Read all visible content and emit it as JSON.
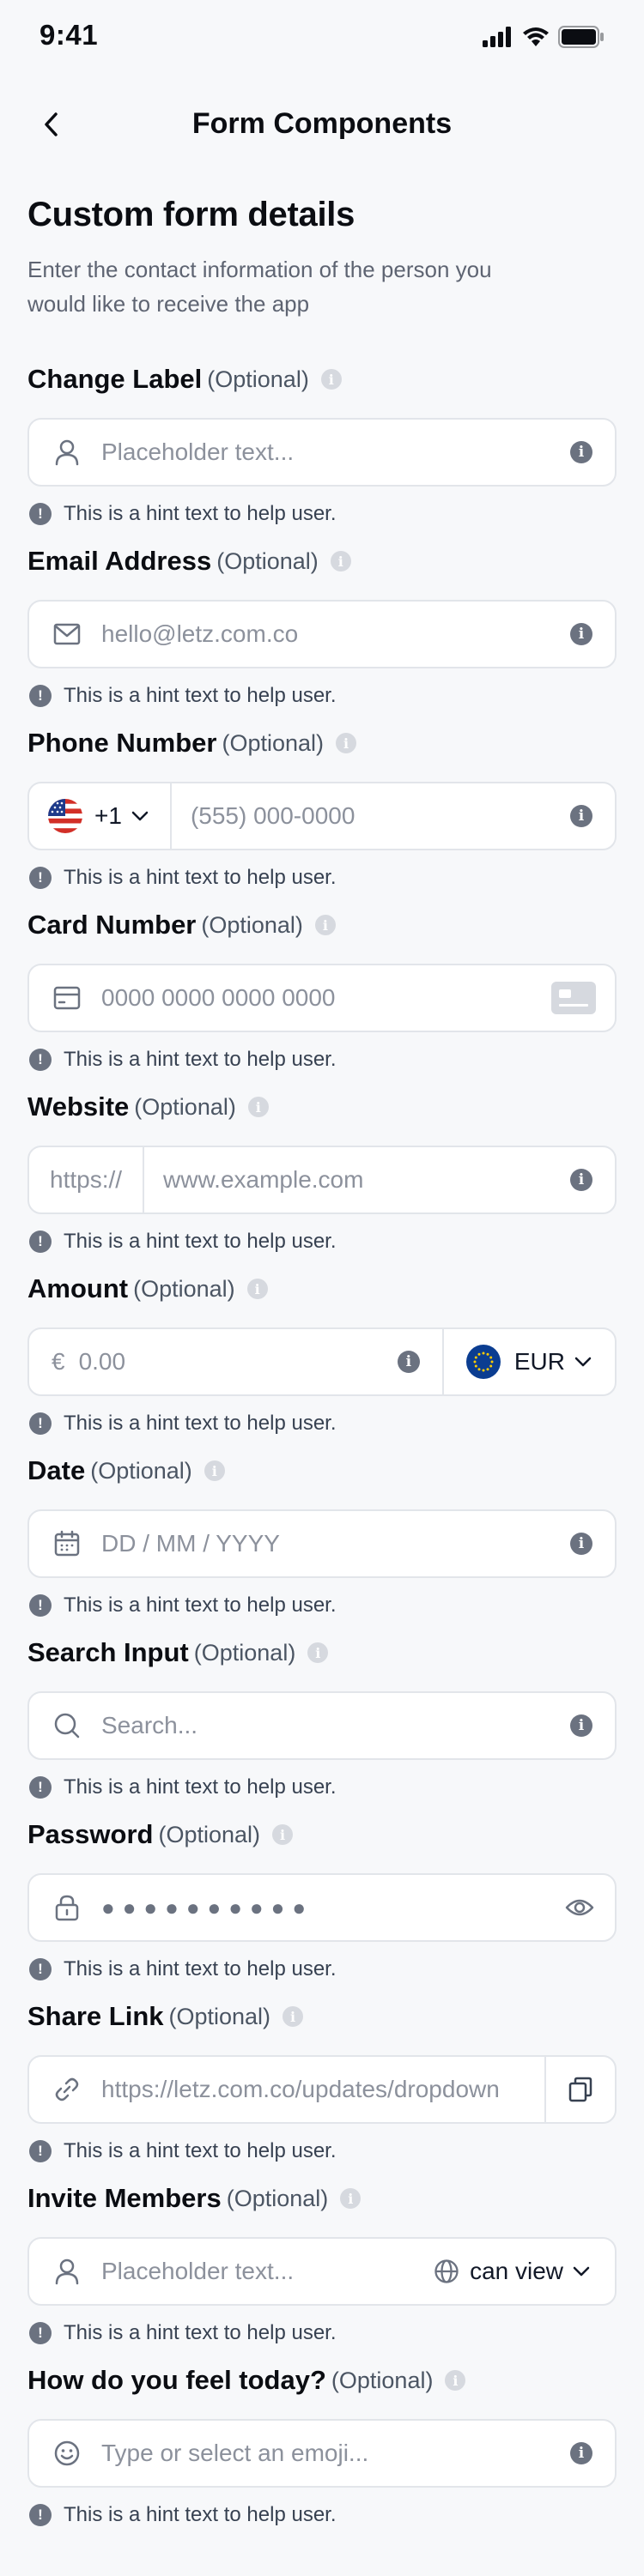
{
  "status_bar": {
    "time": "9:41"
  },
  "nav": {
    "title": "Form Components"
  },
  "header": {
    "title": "Custom form details",
    "subtitle": "Enter the contact information of the person you would like to receive the app"
  },
  "optional_label": "(Optional)",
  "hint_text": "This is a hint text to help user.",
  "fields": {
    "change_label": {
      "label": "Change Label",
      "placeholder": "Placeholder text..."
    },
    "email": {
      "label": "Email Address",
      "placeholder": "hello@letz.com.co"
    },
    "phone": {
      "label": "Phone Number",
      "country_code": "+1",
      "placeholder": "(555) 000-0000"
    },
    "card": {
      "label": "Card Number",
      "placeholder": "0000 0000 0000 0000"
    },
    "website": {
      "label": "Website",
      "prefix": "https://",
      "placeholder": "www.example.com"
    },
    "amount": {
      "label": "Amount",
      "currency_symbol": "€",
      "placeholder": "0.00",
      "currency": "EUR"
    },
    "date": {
      "label": "Date",
      "placeholder": "DD / MM / YYYY"
    },
    "search": {
      "label": "Search Input",
      "placeholder": "Search..."
    },
    "password": {
      "label": "Password",
      "masked_value": "●●●●●●●●●●"
    },
    "share_link": {
      "label": "Share Link",
      "value": "https://letz.com.co/updates/dropdown"
    },
    "invite": {
      "label": "Invite Members",
      "placeholder": "Placeholder text...",
      "permission": "can view"
    },
    "emoji": {
      "label": "How do you feel today?",
      "placeholder": "Type or select an emoji..."
    }
  },
  "colors": {
    "background": "#F7F8FA",
    "border": "#E2E5EA",
    "text_primary": "#0B0D12",
    "text_secondary": "#5E6472",
    "placeholder": "#8C919C",
    "icon_grey": "#6B7280"
  }
}
